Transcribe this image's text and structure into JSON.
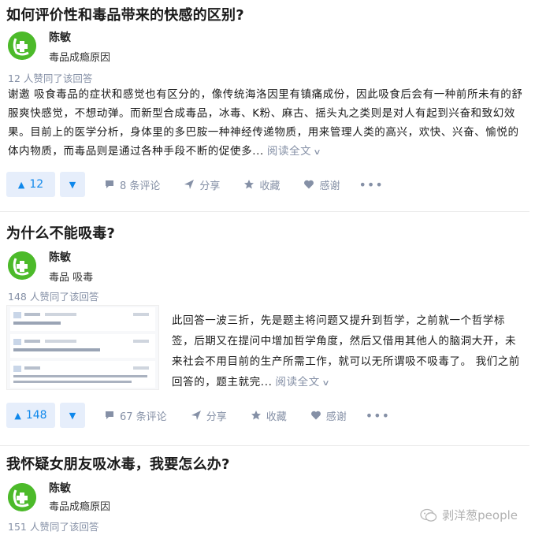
{
  "answers": [
    {
      "question": "如何评价性和毒品带来的快感的区别?",
      "author_name": "陈敏",
      "author_bio": "毒品成瘾原因",
      "votes_line": "12 人赞同了该回答",
      "excerpt": "谢邀 吸食毒品的症状和感觉也有区分的，像传统海洛因里有镇痛成份，因此吸食后会有一种前所未有的舒服爽快感觉，不想动弹。而新型合成毒品，冰毒、K粉、麻古、摇头丸之类则是对人有起到兴奋和致幻效果。目前上的医学分析，身体里的多巴胺一种神经传递物质，用来管理人类的高兴，欢快、兴奋、愉悦的体内物质，而毒品则是通过各种手段不断的促使多...",
      "read_more": "阅读全文",
      "upvotes": "12",
      "comments": "8 条评论",
      "share": "分享",
      "collect": "收藏",
      "thanks": "感谢",
      "more": "•••"
    },
    {
      "question": "为什么不能吸毒?",
      "author_name": "陈敏",
      "author_bio": "毒品 吸毒",
      "votes_line": "148 人赞同了该回答",
      "excerpt": "此回答一波三折，先是题主将问题又提升到哲学，之前就一个哲学标签，后期又在提问中增加哲学角度，然后又借用其他人的脑洞大开，未来社会不用目前的生产所需工作，就可以无所谓吸不吸毒了。 我们之前回答的，题主就完...",
      "read_more": "阅读全文",
      "upvotes": "148",
      "comments": "67 条评论",
      "share": "分享",
      "collect": "收藏",
      "thanks": "感谢",
      "more": "•••"
    },
    {
      "question": "我怀疑女朋友吸冰毒，我要怎么办?",
      "author_name": "陈敏",
      "author_bio": "毒品成瘾原因",
      "votes_line": "151 人赞同了该回答"
    }
  ],
  "watermark": "剥洋葱people",
  "colors": {
    "accent": "#0f88eb",
    "vote_bg": "#e6eefb",
    "meta": "#8590a6",
    "avatar": "#4cba2a"
  }
}
